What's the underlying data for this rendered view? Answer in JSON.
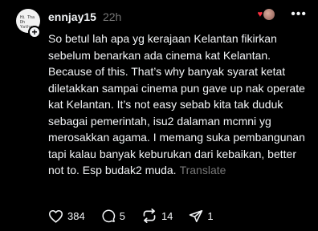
{
  "post": {
    "username": "ennjay15",
    "time": "22h",
    "text": "So betul lah apa yg kerajaan Kelantan fikirkan sebelum benarkan ada cinema kat Kelantan. Because of this. That’s why banyak syarat ketat diletakkan sampai cinema pun gave up nak operate kat Kelantan. It’s not easy sebab kita tak duduk sebagai pemerintah, isu2 dalaman mcmni yg merosakkan agama. I memang suka pembangunan tapi kalau banyak keburukan dari kebaikan, better not to. Esp budak2 muda.",
    "translate_label": "Translate",
    "avatar_text": "Hi Tha Dh Yatha",
    "likes": "384",
    "comments": "5",
    "reposts": "14",
    "shares": "1",
    "icons": [
      "heart-icon",
      "comment-icon",
      "repost-icon",
      "share-icon",
      "more-icon",
      "plus-icon",
      "liked-heart-icon"
    ],
    "accent_color": "#ff3040"
  }
}
